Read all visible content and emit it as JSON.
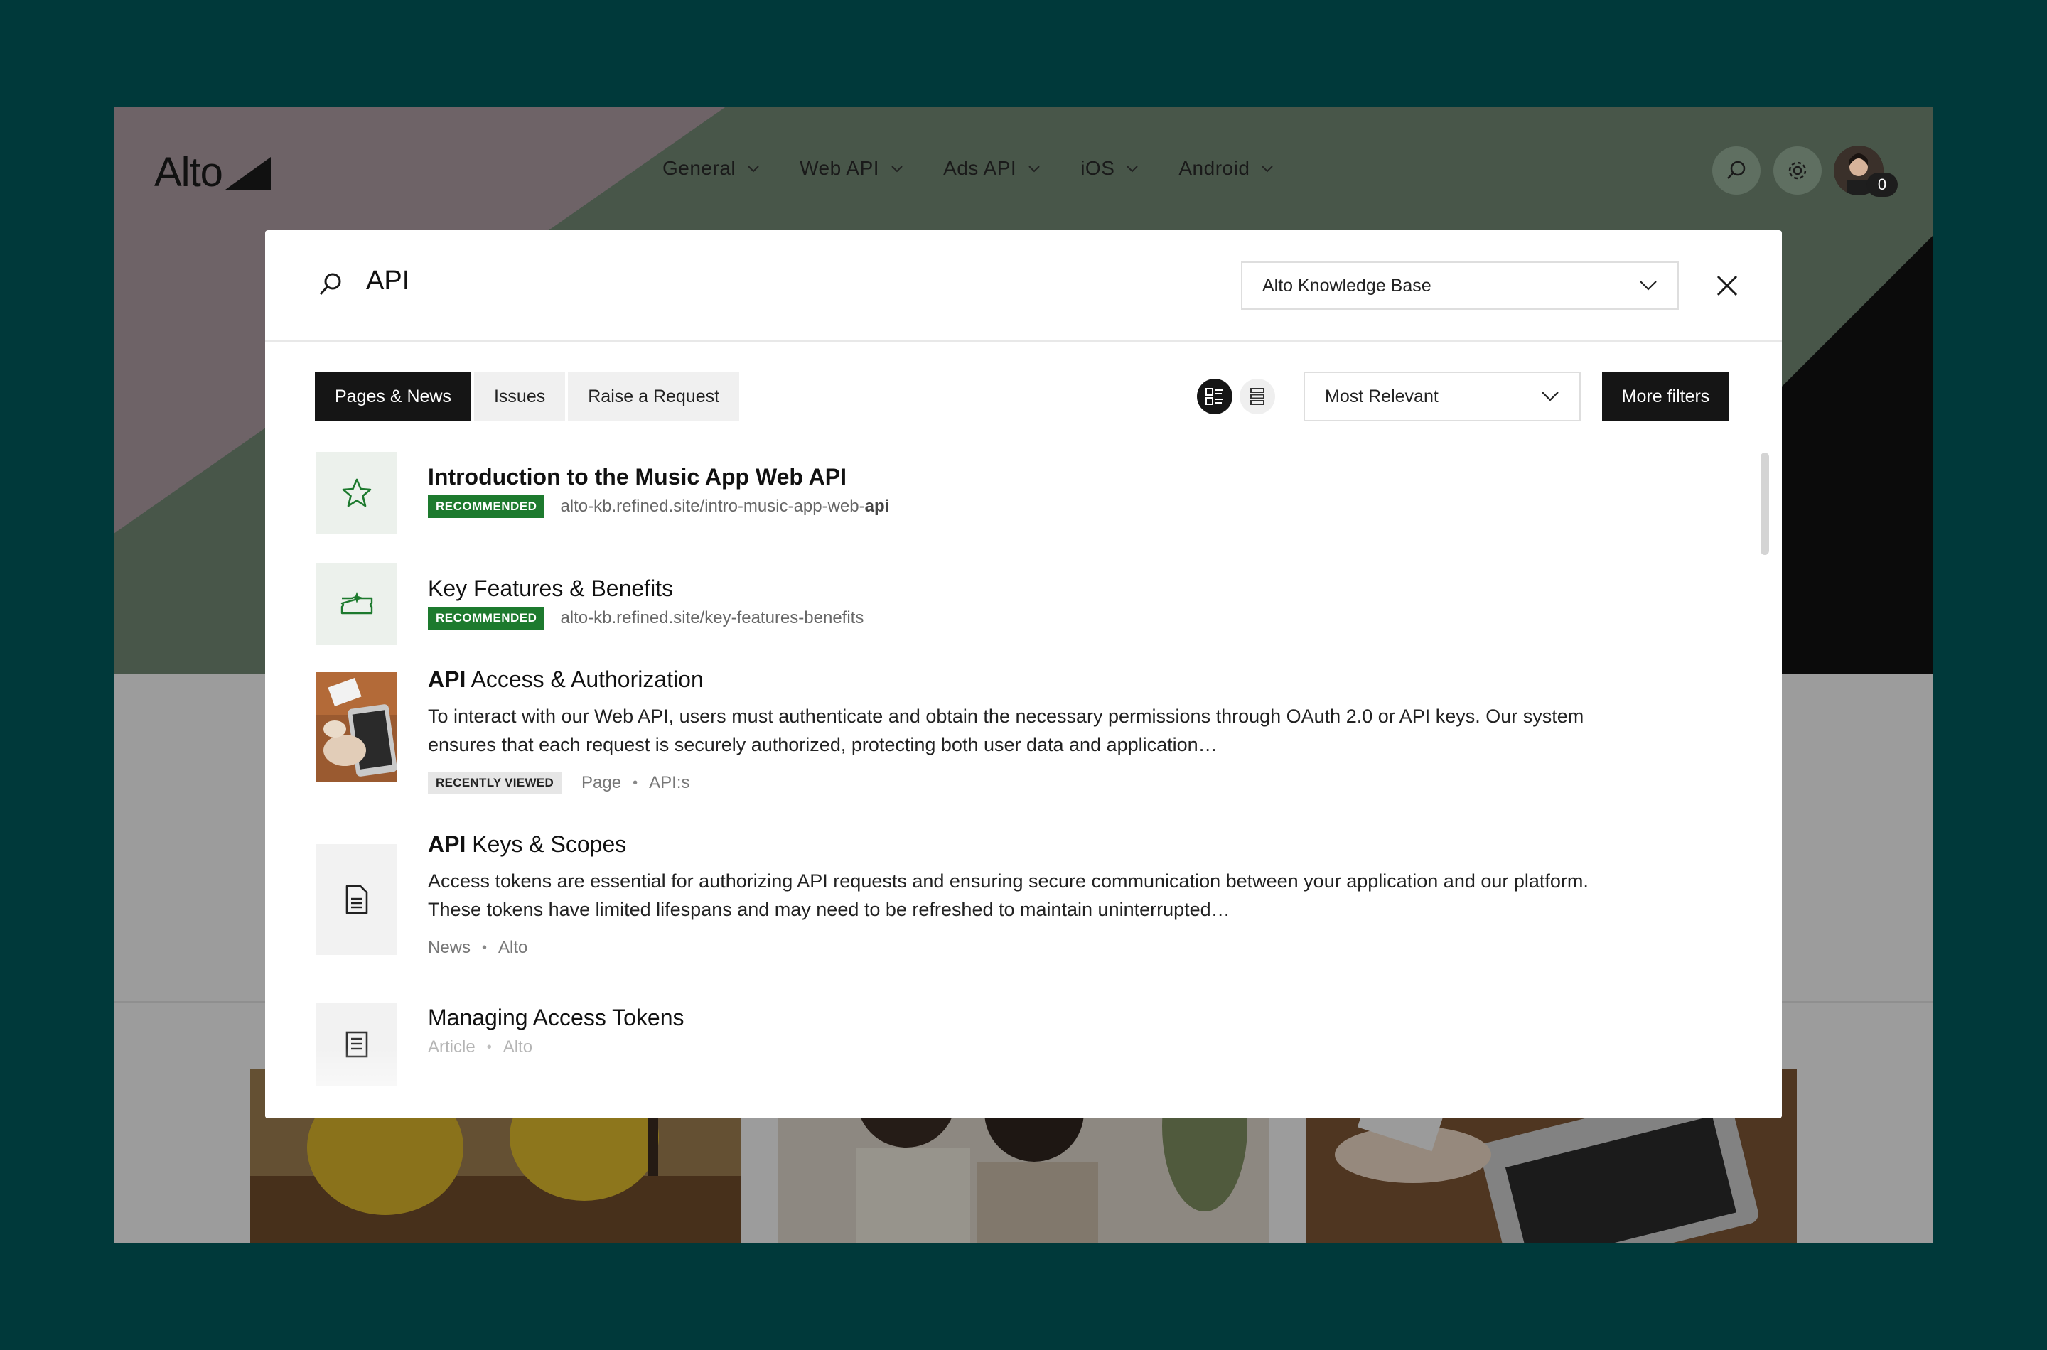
{
  "site": {
    "logo": "Alto",
    "nav": [
      {
        "label": "General"
      },
      {
        "label": "Web API"
      },
      {
        "label": "Ads API"
      },
      {
        "label": "iOS"
      },
      {
        "label": "Android"
      }
    ],
    "notification_count": "0"
  },
  "search": {
    "query": "API",
    "scope": "Alto Knowledge Base"
  },
  "tabs": [
    {
      "label": "Pages & News",
      "active": true
    },
    {
      "label": "Issues",
      "active": false
    },
    {
      "label": "Raise a Request",
      "active": false
    }
  ],
  "sort": {
    "selected": "Most Relevant"
  },
  "more_filters_label": "More filters",
  "results": [
    {
      "title_match": "",
      "title_rest": "Introduction to the Music App Web API",
      "badge": "RECOMMENDED",
      "url_prefix": "alto-kb.refined.site/intro-music-app-web-",
      "url_match": "api",
      "icon": "star-icon"
    },
    {
      "title_match": "",
      "title_rest": "Key Features & Benefits",
      "badge": "RECOMMENDED",
      "url_prefix": "alto-kb.refined.site/key-features-benefits",
      "url_match": "",
      "icon": "ticket-sparkle-icon"
    },
    {
      "title_match": "API",
      "title_rest": " Access & Authorization",
      "description": "To interact with our Web API, users must authenticate and obtain the necessary permissions through OAuth 2.0 or API keys. Our system ensures that each request is securely authorized, protecting both user data and application…",
      "badge": "RECENTLY VIEWED",
      "type": "Page",
      "space": "API:s",
      "icon": "laptop-photo"
    },
    {
      "title_match": "API",
      "title_rest": " Keys & Scopes",
      "description": "Access tokens are essential for authorizing API requests and ensuring secure communication between your application and our platform. These tokens have limited lifespans and may need to be refreshed to maintain uninterrupted…",
      "type": "News",
      "space": "Alto",
      "icon": "document-icon"
    },
    {
      "title_match": "",
      "title_rest": "Managing Access Tokens",
      "type": "Article",
      "space": "Alto",
      "icon": "article-icon"
    }
  ],
  "colors": {
    "page_bg": "#00393a",
    "hero_green": "#6f8471",
    "hero_pink": "#b69bb2",
    "recommended_badge": "#1d7a2e",
    "primary_button": "#151515"
  }
}
